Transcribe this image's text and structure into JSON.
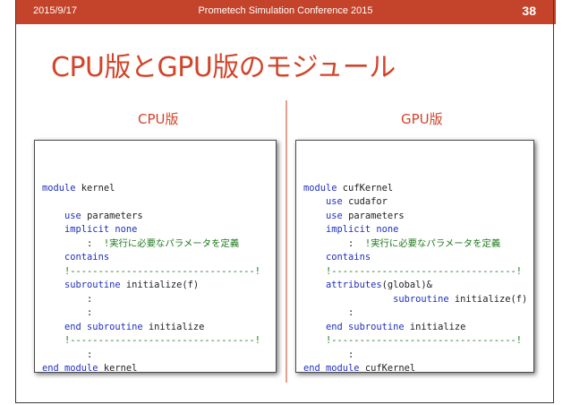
{
  "header": {
    "date": "2015/9/17",
    "conference": "Prometech Simulation Conference 2015",
    "page_number": "38"
  },
  "title": "CPU版とGPU版のモジュール",
  "left": {
    "heading": "CPU版",
    "code": [
      [],
      [
        {
          "t": "module",
          "k": "kw"
        },
        {
          "t": " kernel"
        }
      ],
      [],
      [
        {
          "t": "    "
        },
        {
          "t": "use",
          "k": "kw"
        },
        {
          "t": " parameters"
        }
      ],
      [
        {
          "t": "    "
        },
        {
          "t": "implicit none",
          "k": "kw"
        }
      ],
      [
        {
          "t": "        :  "
        },
        {
          "t": "!実行に必要なパラメータを定義",
          "k": "cm"
        }
      ],
      [
        {
          "t": "    "
        },
        {
          "t": "contains",
          "k": "kw"
        }
      ],
      [
        {
          "t": "    "
        },
        {
          "t": "!---------------------------------!",
          "k": "cm"
        }
      ],
      [
        {
          "t": "    "
        },
        {
          "t": "subroutine",
          "k": "kw"
        },
        {
          "t": " initialize(f)"
        }
      ],
      [
        {
          "t": "        :"
        }
      ],
      [
        {
          "t": "        :"
        }
      ],
      [
        {
          "t": "    "
        },
        {
          "t": "end subroutine",
          "k": "kw"
        },
        {
          "t": " initialize"
        }
      ],
      [
        {
          "t": "    "
        },
        {
          "t": "!---------------------------------!",
          "k": "cm"
        }
      ],
      [
        {
          "t": "        :"
        }
      ],
      [
        {
          "t": "end module",
          "k": "kw"
        },
        {
          "t": " kernel"
        }
      ]
    ]
  },
  "right": {
    "heading": "GPU版",
    "code": [
      [],
      [
        {
          "t": "module",
          "k": "kw"
        },
        {
          "t": " cufKernel"
        }
      ],
      [
        {
          "t": "    "
        },
        {
          "t": "use",
          "k": "kw"
        },
        {
          "t": " cudafor"
        }
      ],
      [
        {
          "t": "    "
        },
        {
          "t": "use",
          "k": "kw"
        },
        {
          "t": " parameters"
        }
      ],
      [
        {
          "t": "    "
        },
        {
          "t": "implicit none",
          "k": "kw"
        }
      ],
      [
        {
          "t": "        :  "
        },
        {
          "t": "!実行に必要なパラメータを定義",
          "k": "cm"
        }
      ],
      [
        {
          "t": "    "
        },
        {
          "t": "contains",
          "k": "kw"
        }
      ],
      [
        {
          "t": "    "
        },
        {
          "t": "!---------------------------------!",
          "k": "cm"
        }
      ],
      [
        {
          "t": "    "
        },
        {
          "t": "attributes",
          "k": "kw"
        },
        {
          "t": "(global)&"
        }
      ],
      [
        {
          "t": "                "
        },
        {
          "t": "subroutine",
          "k": "kw"
        },
        {
          "t": " initialize(f)"
        }
      ],
      [
        {
          "t": "        :"
        }
      ],
      [
        {
          "t": "    "
        },
        {
          "t": "end subroutine",
          "k": "kw"
        },
        {
          "t": " initialize"
        }
      ],
      [
        {
          "t": "    "
        },
        {
          "t": "!---------------------------------!",
          "k": "cm"
        }
      ],
      [
        {
          "t": "        :"
        }
      ],
      [
        {
          "t": "end module",
          "k": "kw"
        },
        {
          "t": " cufKernel"
        }
      ]
    ]
  }
}
